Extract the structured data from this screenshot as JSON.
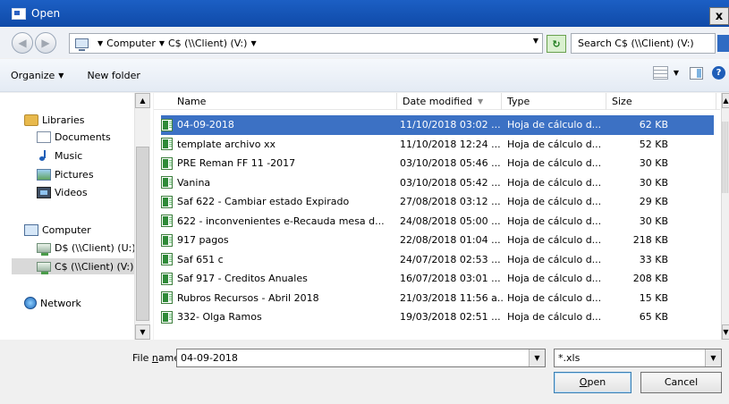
{
  "window": {
    "title": "Open",
    "close_label": "x"
  },
  "address": {
    "crumbs": [
      "Computer",
      "C$ (\\\\Client) (V:)"
    ],
    "search_placeholder": "Search C$ (\\\\Client) (V:)"
  },
  "toolbar": {
    "organize": "Organize",
    "new_folder": "New folder"
  },
  "nav": {
    "libraries": "Libraries",
    "documents": "Documents",
    "music": "Music",
    "pictures": "Pictures",
    "videos": "Videos",
    "computer": "Computer",
    "drive_d": "D$ (\\\\Client) (U:)",
    "drive_c": "C$ (\\\\Client) (V:)",
    "network": "Network"
  },
  "columns": {
    "name": "Name",
    "date": "Date modified",
    "type": "Type",
    "size": "Size"
  },
  "files": [
    {
      "name": "04-09-2018",
      "date": "11/10/2018 03:02 ...",
      "type": "Hoja de cálculo d...",
      "size": "62 KB",
      "selected": true
    },
    {
      "name": "template archivo xx",
      "date": "11/10/2018 12:24 ...",
      "type": "Hoja de cálculo d...",
      "size": "52 KB"
    },
    {
      "name": "PRE Reman FF 11 -2017",
      "date": "03/10/2018 05:46 ...",
      "type": "Hoja de cálculo d...",
      "size": "30 KB"
    },
    {
      "name": "Vanina",
      "date": "03/10/2018 05:42 ...",
      "type": "Hoja de cálculo d...",
      "size": "30 KB"
    },
    {
      "name": "Saf 622 - Cambiar estado Expirado",
      "date": "27/08/2018 03:12 ...",
      "type": "Hoja de cálculo d...",
      "size": "29 KB"
    },
    {
      "name": "622 - inconvenientes e-Recauda  mesa d...",
      "date": "24/08/2018 05:00 ...",
      "type": "Hoja de cálculo d...",
      "size": "30 KB"
    },
    {
      "name": "917 pagos",
      "date": "22/08/2018 01:04 ...",
      "type": "Hoja de cálculo d...",
      "size": "218 KB"
    },
    {
      "name": "Saf 651 c",
      "date": "24/07/2018 02:53 ...",
      "type": "Hoja de cálculo d...",
      "size": "33 KB"
    },
    {
      "name": "Saf 917 - Creditos Anuales",
      "date": "16/07/2018 03:01 ...",
      "type": "Hoja de cálculo d...",
      "size": "208 KB"
    },
    {
      "name": "Rubros Recursos - Abril 2018",
      "date": "21/03/2018 11:56 a...",
      "type": "Hoja de cálculo d...",
      "size": "15 KB"
    },
    {
      "name": "332- Olga Ramos",
      "date": "19/03/2018 02:51 ...",
      "type": "Hoja de cálculo d...",
      "size": "65 KB"
    }
  ],
  "bottom": {
    "file_name_label_pre": "File ",
    "file_name_label_u": "n",
    "file_name_label_post": "ame:",
    "file_name_value": "04-09-2018",
    "filter_value": "*.xls",
    "open_u": "O",
    "open_rest": "pen",
    "cancel": "Cancel"
  },
  "colors": {
    "selection": "#3c71c4",
    "titlebar": "#1c5fc4"
  },
  "icons": [
    "app-icon",
    "back-icon",
    "forward-icon",
    "computer-icon",
    "refresh-icon",
    "search-icon",
    "views-icon",
    "preview-pane-icon",
    "help-icon",
    "libraries-icon",
    "documents-icon",
    "music-icon",
    "pictures-icon",
    "videos-icon",
    "drive-icon",
    "network-icon",
    "excel-file-icon"
  ]
}
